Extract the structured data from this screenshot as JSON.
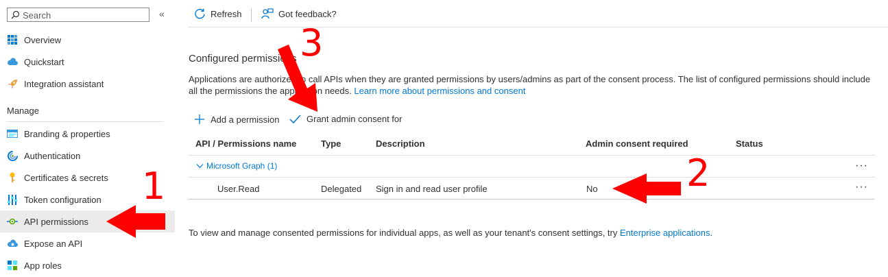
{
  "sidebar": {
    "search_placeholder": "Search",
    "collapse_glyph": "«",
    "items_top": [
      {
        "label": "Overview",
        "icon": "grid-icon"
      },
      {
        "label": "Quickstart",
        "icon": "cloud-icon"
      },
      {
        "label": "Integration assistant",
        "icon": "rocket-icon"
      }
    ],
    "manage_header": "Manage",
    "items_manage": [
      {
        "label": "Branding & properties",
        "icon": "branding-icon"
      },
      {
        "label": "Authentication",
        "icon": "authentication-icon"
      },
      {
        "label": "Certificates & secrets",
        "icon": "key-icon"
      },
      {
        "label": "Token configuration",
        "icon": "token-config-icon"
      },
      {
        "label": "API permissions",
        "icon": "api-permissions-icon",
        "selected": true
      },
      {
        "label": "Expose an API",
        "icon": "expose-api-icon"
      },
      {
        "label": "App roles",
        "icon": "app-roles-icon"
      }
    ]
  },
  "toolbar": {
    "refresh_label": "Refresh",
    "feedback_label": "Got feedback?"
  },
  "main": {
    "section_title": "Configured permissions",
    "description": "Applications are authorized to call APIs when they are granted permissions by users/admins as part of the consent process. The list of configured permissions should include all the permissions the application needs. ",
    "learn_more_link": "Learn more about permissions and consent",
    "add_permission_label": "Add a permission",
    "grant_consent_label": "Grant admin consent for",
    "table": {
      "headers": [
        "API / Permissions name",
        "Type",
        "Description",
        "Admin consent required",
        "Status"
      ],
      "group": {
        "name": "Microsoft Graph (1)"
      },
      "rows": [
        {
          "name": "User.Read",
          "type": "Delegated",
          "description": "Sign in and read user profile",
          "admin_consent": "No",
          "status": ""
        }
      ],
      "more_glyph": "···"
    },
    "footer_text": "To view and manage consented permissions for individual apps, as well as your tenant's consent settings, try ",
    "footer_link": "Enterprise applications",
    "footer_end": "."
  },
  "annotations": {
    "label_1": "1",
    "label_2": "2",
    "label_3": "3",
    "color": "#ff0000"
  },
  "colors": {
    "accent": "#0078d4",
    "selected_bg": "#edebe9",
    "text": "#323130"
  }
}
